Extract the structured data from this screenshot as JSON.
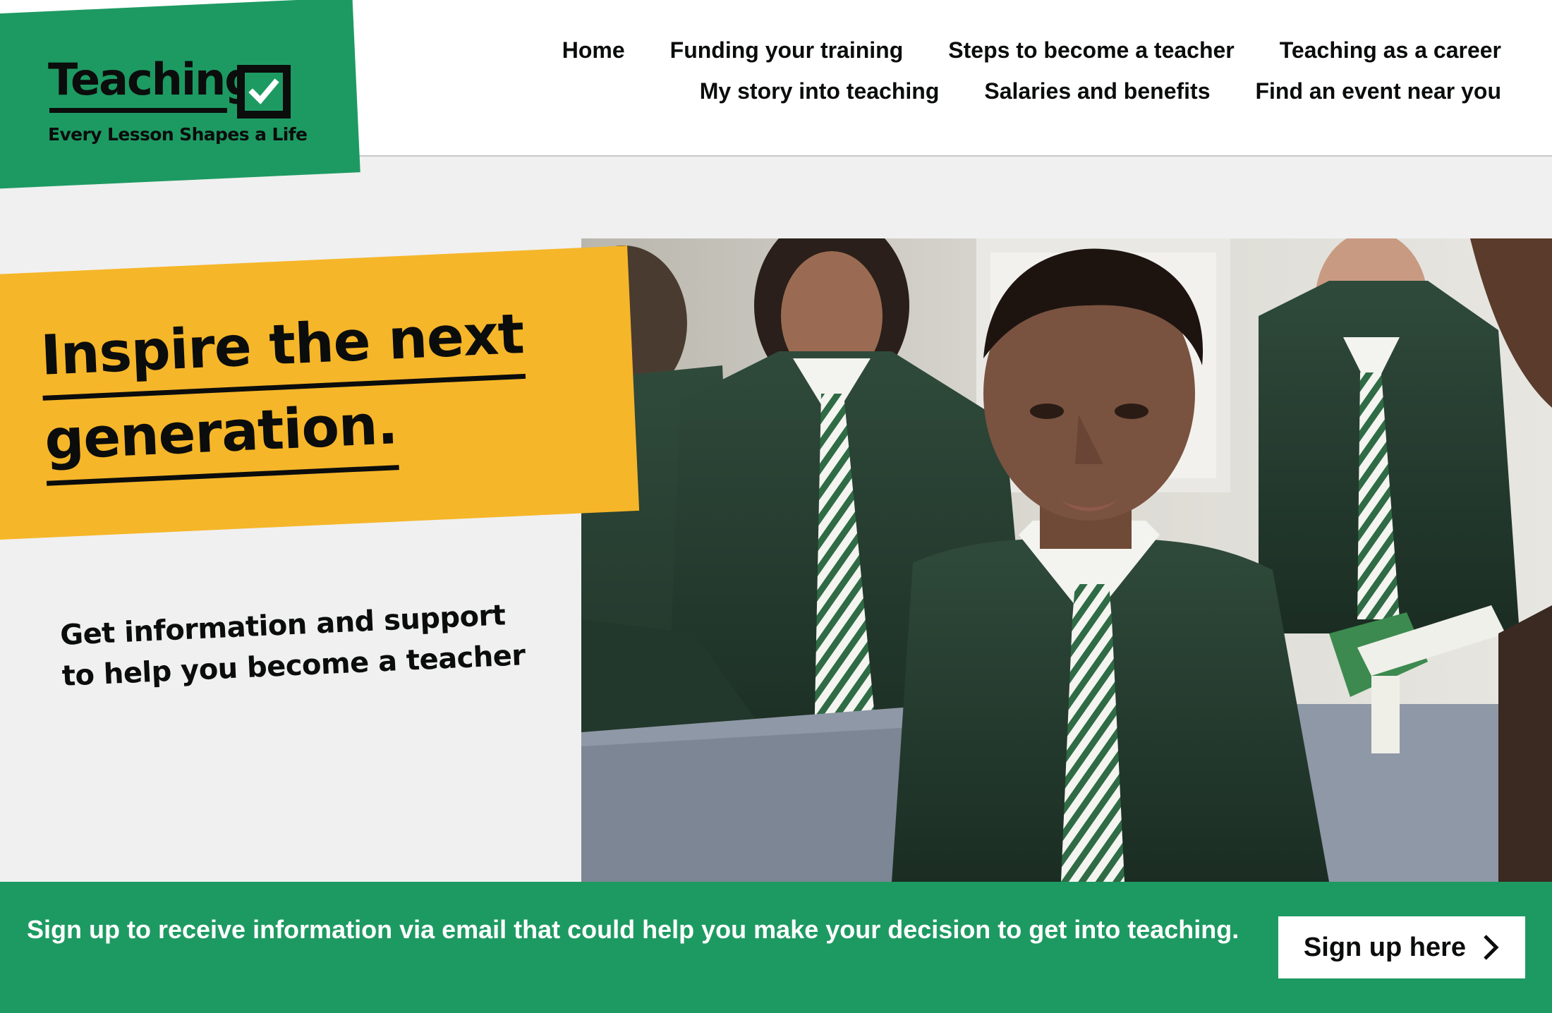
{
  "brand": {
    "wordmark": "Teaching",
    "tagline": "Every Lesson Shapes a Life",
    "logo_icon": "checkbox-tick-icon",
    "green": "#1d9a62",
    "yellow": "#f5b629"
  },
  "nav": {
    "row1": [
      {
        "label": "Home"
      },
      {
        "label": "Funding your training"
      },
      {
        "label": "Steps to become a teacher"
      },
      {
        "label": "Teaching as a career"
      }
    ],
    "row2": [
      {
        "label": "My story into teaching"
      },
      {
        "label": "Salaries and benefits"
      },
      {
        "label": "Find an event near you"
      }
    ]
  },
  "hero": {
    "headline_line1": "Inspire the next",
    "headline_line2": "generation.",
    "subtext": "Get information and support to help you become a teacher",
    "image_alt": "Students in green school uniforms in a classroom"
  },
  "signup": {
    "text": "Sign up to receive information via email that could help you make your decision to get into teaching.",
    "button_label": "Sign up here",
    "button_icon": "chevron-right-icon"
  }
}
